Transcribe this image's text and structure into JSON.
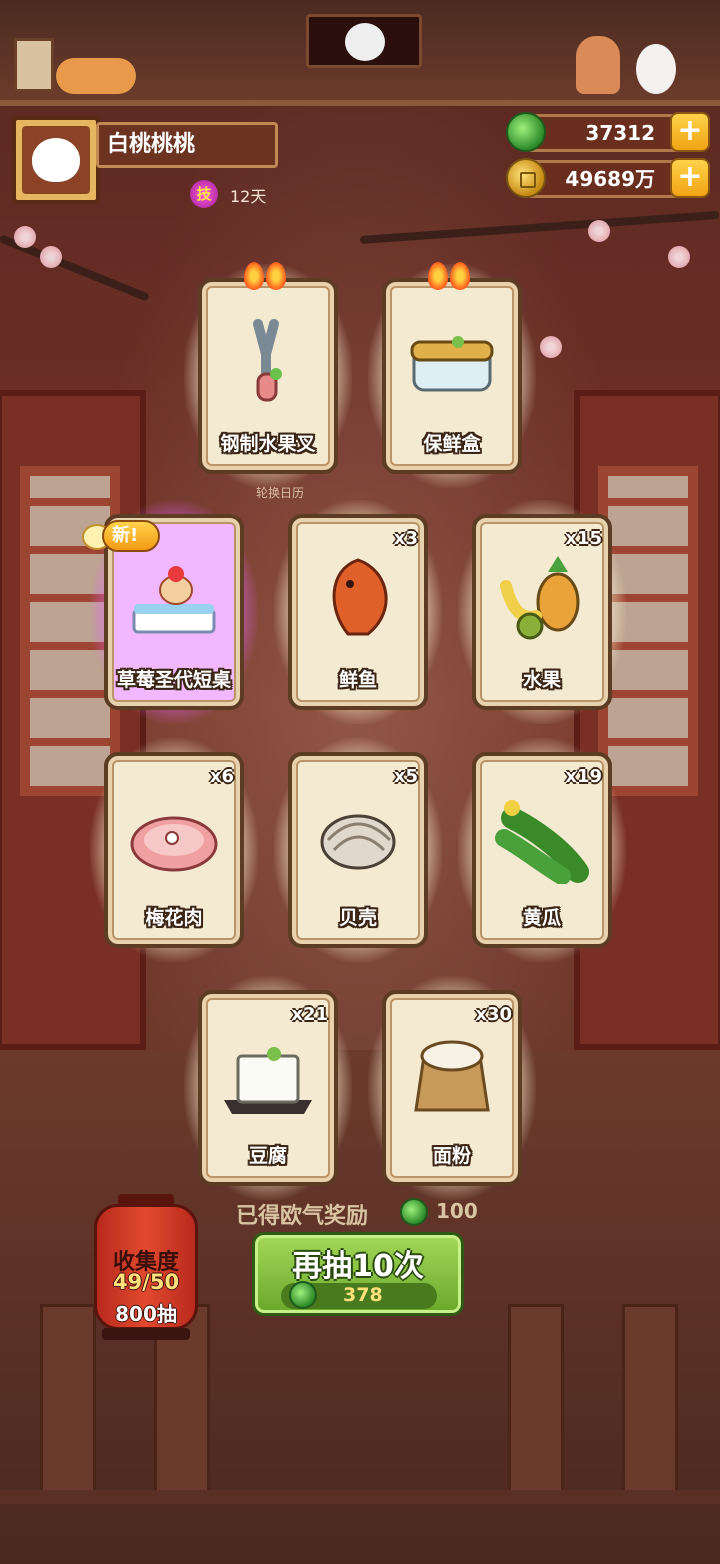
{
  "profile": {
    "name": "白桃桃桃",
    "skill_badge": "技",
    "days": "12天"
  },
  "currency": {
    "jade": "37312",
    "coins": "49689万"
  },
  "calendar_label": "轮换日历",
  "cards": [
    {
      "name": "钢制水果叉",
      "qty": "",
      "rarity": "hot",
      "icon": "steel-fruit-fork-icon"
    },
    {
      "name": "保鲜盒",
      "qty": "",
      "rarity": "hot",
      "icon": "crisper-box-icon"
    },
    {
      "name": "草莓圣代短桌",
      "qty": "",
      "rarity": "new",
      "badge": "新!",
      "icon": "strawberry-sundae-table-icon"
    },
    {
      "name": "鲜鱼",
      "qty": "x3",
      "icon": "fish-icon"
    },
    {
      "name": "水果",
      "qty": "x15",
      "icon": "fruit-icon"
    },
    {
      "name": "梅花肉",
      "qty": "x6",
      "icon": "pork-icon"
    },
    {
      "name": "贝壳",
      "qty": "x5",
      "icon": "shell-icon"
    },
    {
      "name": "黄瓜",
      "qty": "x19",
      "icon": "cucumber-icon"
    },
    {
      "name": "豆腐",
      "qty": "x21",
      "icon": "tofu-icon"
    },
    {
      "name": "面粉",
      "qty": "x30",
      "icon": "flour-icon"
    }
  ],
  "reward": {
    "label": "已得欧气奖励",
    "value": "100"
  },
  "collection": {
    "title": "收集度",
    "progress": "49/50",
    "draws": "800抽"
  },
  "draw_button": {
    "label": "再抽10次",
    "cost": "378"
  },
  "colors": {
    "accent_green": "#6aa82a",
    "gold": "#f0a414",
    "card_bg": "#f4ead2"
  }
}
